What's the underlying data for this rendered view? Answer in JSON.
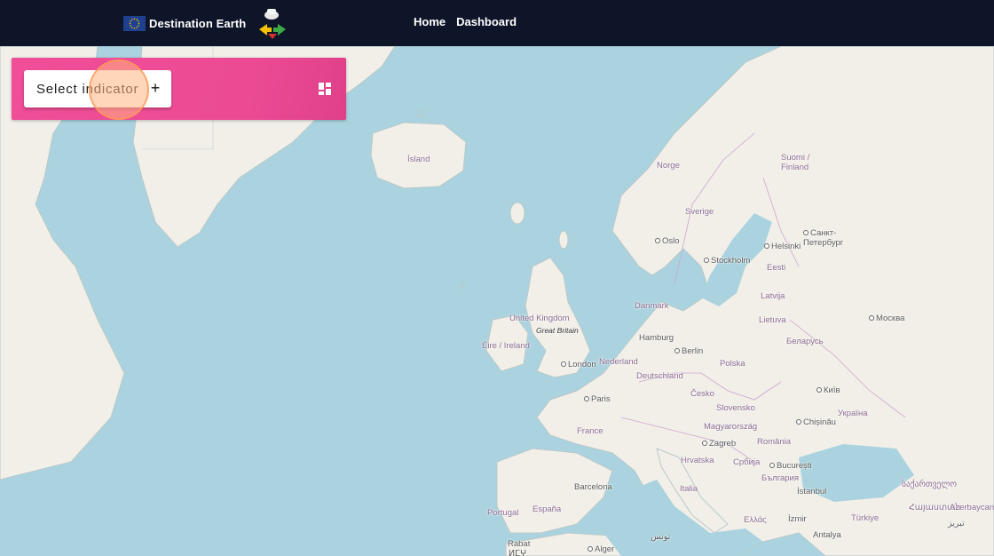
{
  "header": {
    "brand": "Destination Earth",
    "nav": [
      "Home",
      "Dashboard"
    ],
    "colors": {
      "bar": "#0e1529",
      "accent": "#f04e98"
    }
  },
  "panel": {
    "select_label": "Select indicator",
    "plus": "+"
  },
  "map": {
    "labels": [
      {
        "text": "Ísland",
        "type": "country"
      },
      {
        "text": "Norge",
        "type": "country"
      },
      {
        "text": "Sverige",
        "type": "country"
      },
      {
        "text": "Suomi / Finland",
        "type": "country"
      },
      {
        "text": "Oslo",
        "type": "city"
      },
      {
        "text": "Stockholm",
        "type": "city"
      },
      {
        "text": "Helsinki",
        "type": "city"
      },
      {
        "text": "Санкт-Петербург",
        "type": "city"
      },
      {
        "text": "Eesti",
        "type": "country"
      },
      {
        "text": "Latvija",
        "type": "country"
      },
      {
        "text": "Lietuva",
        "type": "country"
      },
      {
        "text": "Danmark",
        "type": "country"
      },
      {
        "text": "United Kingdom",
        "type": "country"
      },
      {
        "text": "Great Britain",
        "type": "italic"
      },
      {
        "text": "Éire / Ireland",
        "type": "country"
      },
      {
        "text": "London",
        "type": "city"
      },
      {
        "text": "Nederland",
        "type": "country"
      },
      {
        "text": "Hamburg",
        "type": "plain"
      },
      {
        "text": "Berlin",
        "type": "city"
      },
      {
        "text": "Deutschland",
        "type": "country"
      },
      {
        "text": "Polska",
        "type": "country"
      },
      {
        "text": "Беларусь",
        "type": "country"
      },
      {
        "text": "Москва",
        "type": "city"
      },
      {
        "text": "Paris",
        "type": "city"
      },
      {
        "text": "Česko",
        "type": "country"
      },
      {
        "text": "Київ",
        "type": "city"
      },
      {
        "text": "Slovensko",
        "type": "country"
      },
      {
        "text": "Україна",
        "type": "country"
      },
      {
        "text": "France",
        "type": "country"
      },
      {
        "text": "Magyarország",
        "type": "country"
      },
      {
        "text": "Chișinău",
        "type": "city"
      },
      {
        "text": "Zagreb",
        "type": "city"
      },
      {
        "text": "România",
        "type": "country"
      },
      {
        "text": "Hrvatska",
        "type": "country"
      },
      {
        "text": "Србија",
        "type": "country"
      },
      {
        "text": "București",
        "type": "city"
      },
      {
        "text": "Barcelona",
        "type": "plain"
      },
      {
        "text": "Italia",
        "type": "country"
      },
      {
        "text": "България",
        "type": "country"
      },
      {
        "text": "Portugal",
        "type": "country"
      },
      {
        "text": "España",
        "type": "country"
      },
      {
        "text": "İstanbul",
        "type": "plain"
      },
      {
        "text": "Ελλάς",
        "type": "country"
      },
      {
        "text": "İzmir",
        "type": "plain"
      },
      {
        "text": "Türkiye",
        "type": "country"
      },
      {
        "text": "Antalya",
        "type": "plain"
      },
      {
        "text": "Rabat",
        "type": "plain"
      },
      {
        "text": "Alger",
        "type": "city"
      },
      {
        "text": "تونس",
        "type": "plain"
      },
      {
        "text": "საქართველო",
        "type": "country"
      },
      {
        "text": "Հայաստան",
        "type": "country"
      },
      {
        "text": "Azerbaycan",
        "type": "country"
      },
      {
        "text": "تبریز",
        "type": "plain"
      },
      {
        "text": "ⵍⵎⵖ",
        "type": "plain"
      }
    ]
  }
}
